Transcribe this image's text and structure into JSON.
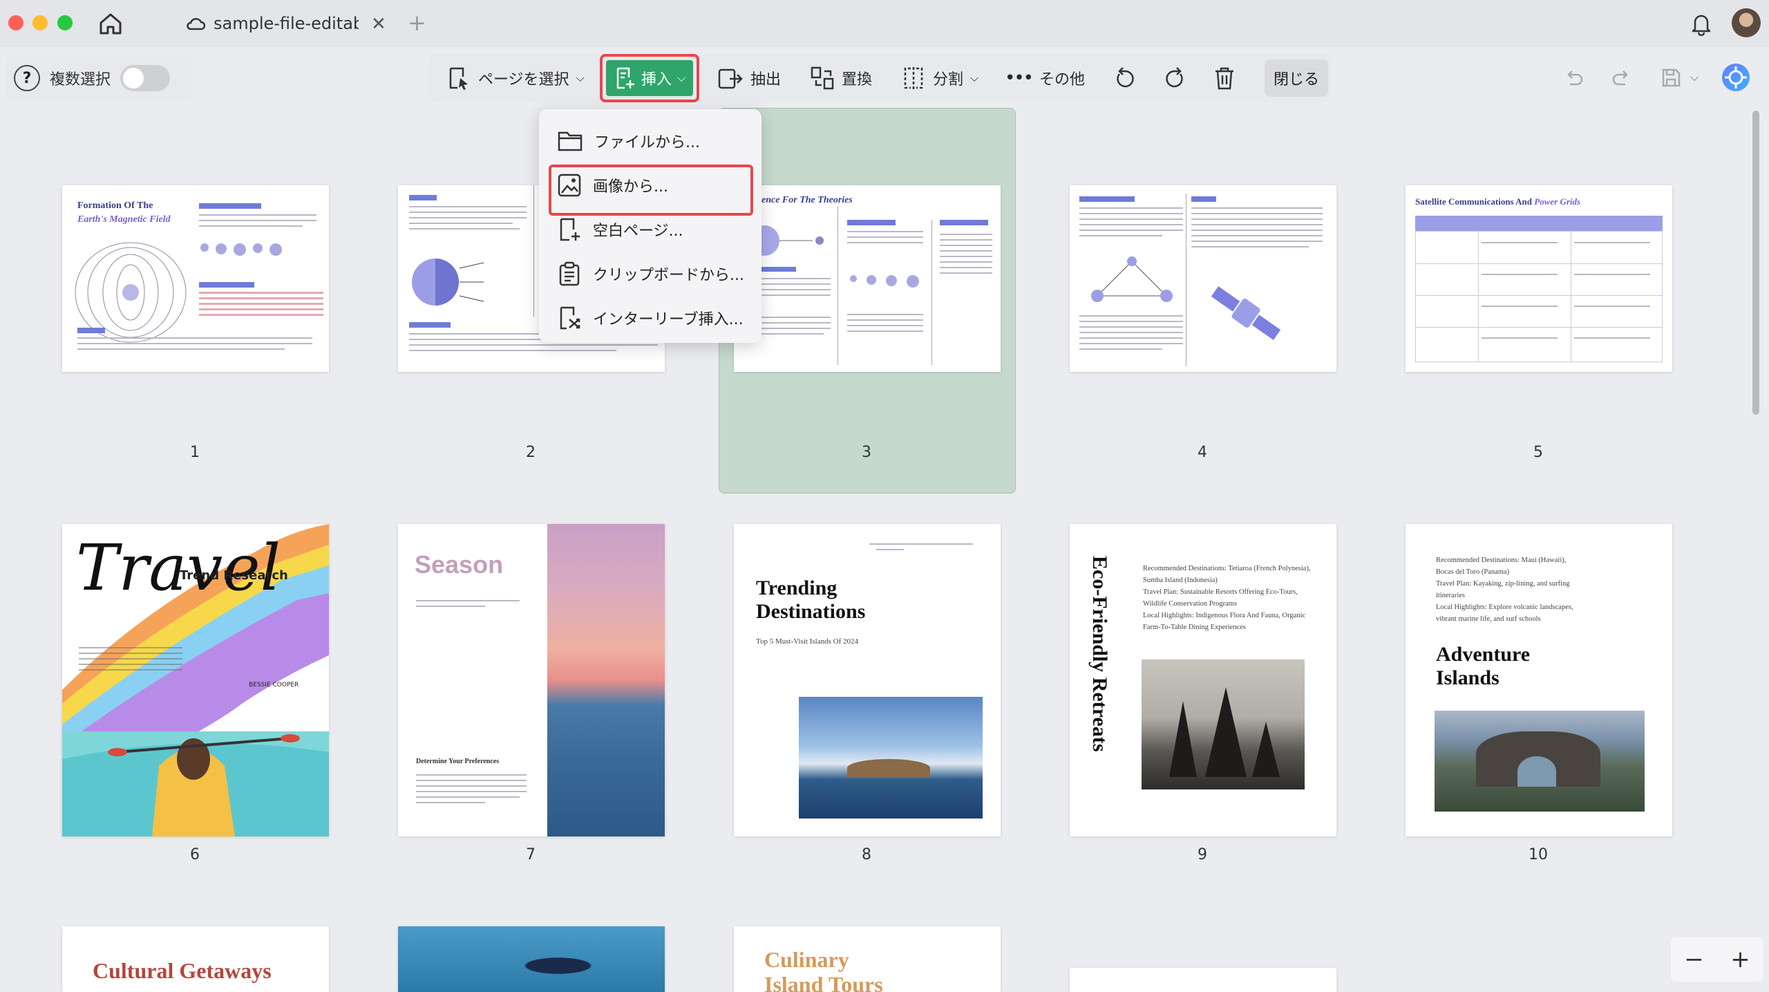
{
  "window": {
    "tab_title": "sample-file-editable"
  },
  "toolbar_left": {
    "multi_select_label": "複数選択"
  },
  "toolbar": {
    "select_pages": "ページを選択",
    "insert": "挿入",
    "extract": "抽出",
    "replace": "置換",
    "split": "分割",
    "more": "その他",
    "close": "閉じる"
  },
  "insert_menu": [
    {
      "label": "ファイルから..."
    },
    {
      "label": "画像から..."
    },
    {
      "label": "空白ページ..."
    },
    {
      "label": "クリップボードから..."
    },
    {
      "label": "インターリーブ挿入..."
    }
  ],
  "pages": [
    {
      "number": "1",
      "title": "Formation Of The",
      "subtitle": "Earth's Magnetic Field"
    },
    {
      "number": "2"
    },
    {
      "number": "3",
      "title": "ence For The Theories"
    },
    {
      "number": "4"
    },
    {
      "number": "5",
      "title": "Satellite Communications And",
      "title_em": "Power Grids"
    },
    {
      "number": "6",
      "script": "Travel",
      "title": "Trend Research",
      "author": "BESSIE COOPER"
    },
    {
      "number": "7",
      "title": "Season",
      "section": "Determine Your Preferences"
    },
    {
      "number": "8",
      "title": "Trending Destinations",
      "subtitle": "Top 5 Must-Visit Islands Of 2024"
    },
    {
      "number": "9",
      "title": "Eco-Friendly Retreats"
    },
    {
      "number": "10",
      "title": "Adventure Islands"
    },
    {
      "number": "",
      "title": "Cultural Getaways"
    },
    {
      "number": ""
    },
    {
      "number": "",
      "title": "Culinary Island Tours"
    }
  ],
  "page9_text": [
    "Recommended Destinations: Tetiaroa (French Polynesia),",
    "Sumba Island (Indonesia)",
    "Travel Plan: Sustainable Resorts Offering Eco-Tours,",
    "Wildlife Conservation Programs",
    "Local Highlights: Indigenous Flora And Fauna, Organic",
    "Farm-To-Table Dining Experiences"
  ],
  "page10_text": [
    "Recommended Destinations: Maui (Hawaii),",
    "Bocas del Toro (Panama)",
    "Travel Plan: Kayaking, zip-lining, and surfing",
    "itineraries",
    "Local Highlights: Explore volcanic landscapes,",
    "vibrant marine life, and surf schools"
  ],
  "zoom": {
    "minus": "−",
    "plus": "+"
  },
  "colors": {
    "accent_green": "#2fa56b",
    "highlight_red": "#e8474d",
    "selected_bg": "#c5d9cd"
  }
}
